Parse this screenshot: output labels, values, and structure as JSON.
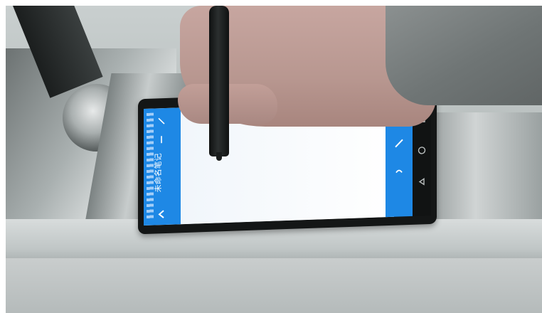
{
  "photo": {
    "tablet_app": {
      "title": "未命名笔记"
    },
    "icons": {
      "back": "back-arrow-icon",
      "pen_tool": "pen-icon",
      "color_tool": "color-dot-icon",
      "undo_tool": "undo-icon",
      "nav_recent": "recent-apps-icon",
      "nav_home": "home-icon",
      "nav_back": "nav-back-icon"
    },
    "colors": {
      "accent_blue": "#1e88e5",
      "screen_white": "#f7fbff",
      "bezel": "#141616"
    }
  }
}
